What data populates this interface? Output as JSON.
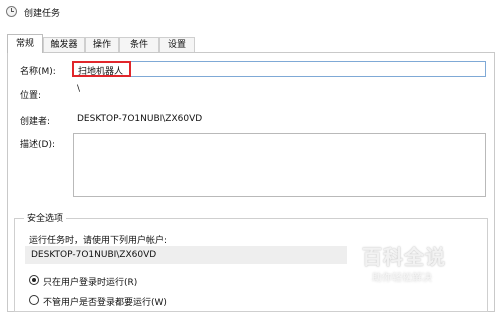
{
  "window": {
    "title": "创建任务"
  },
  "tabs": [
    {
      "label": "常规",
      "active": true
    },
    {
      "label": "触发器",
      "active": false
    },
    {
      "label": "操作",
      "active": false
    },
    {
      "label": "条件",
      "active": false
    },
    {
      "label": "设置",
      "active": false
    }
  ],
  "general": {
    "name_label": "名称(M):",
    "name_value": "扫地机器人",
    "location_label": "位置:",
    "location_value": "\\",
    "author_label": "创建者:",
    "author_value": "DESKTOP-7O1NUBI\\ZX60VD",
    "description_label": "描述(D):",
    "description_value": ""
  },
  "security": {
    "group_title": "安全选项",
    "run_as_label": "运行任务时，请使用下列用户帐户:",
    "user_account": "DESKTOP-7O1NUBI\\ZX60VD",
    "options": [
      {
        "label": "只在用户登录时运行(R)",
        "selected": true
      },
      {
        "label": "不管用户是否登录都要运行(W)",
        "selected": false
      }
    ]
  },
  "watermark": {
    "brand": "百科全说",
    "tagline": "助你轻松解决"
  },
  "colors": {
    "highlight_box": "#e0262b",
    "focus_border": "#7fa9d6"
  }
}
